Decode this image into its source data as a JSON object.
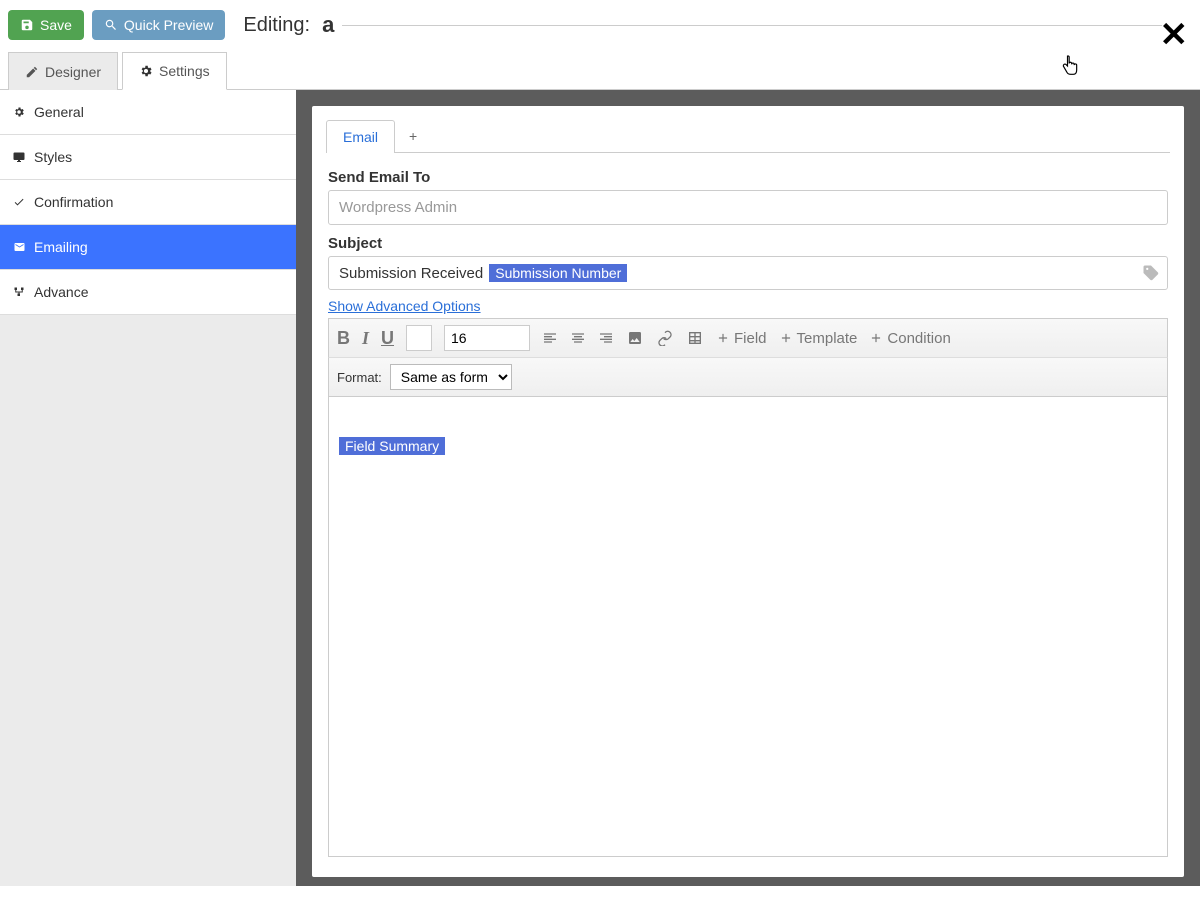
{
  "top": {
    "save": "Save",
    "preview": "Quick Preview",
    "editing_label": "Editing:",
    "editing_value": "a"
  },
  "tabs": {
    "designer": "Designer",
    "settings": "Settings"
  },
  "sidebar": {
    "general": "General",
    "styles": "Styles",
    "confirmation": "Confirmation",
    "emailing": "Emailing",
    "advance": "Advance"
  },
  "email": {
    "tab_label": "Email",
    "send_to_label": "Send Email To",
    "send_to_placeholder": "Wordpress Admin",
    "subject_label": "Subject",
    "subject_text": "Submission Received",
    "subject_tag": "Submission Number",
    "advanced_link": "Show Advanced Options",
    "font_size": "16",
    "tb_field": "Field",
    "tb_template": "Template",
    "tb_condition": "Condition",
    "format_label": "Format:",
    "format_value": "Same as form",
    "body_tag": "Field Summary"
  }
}
